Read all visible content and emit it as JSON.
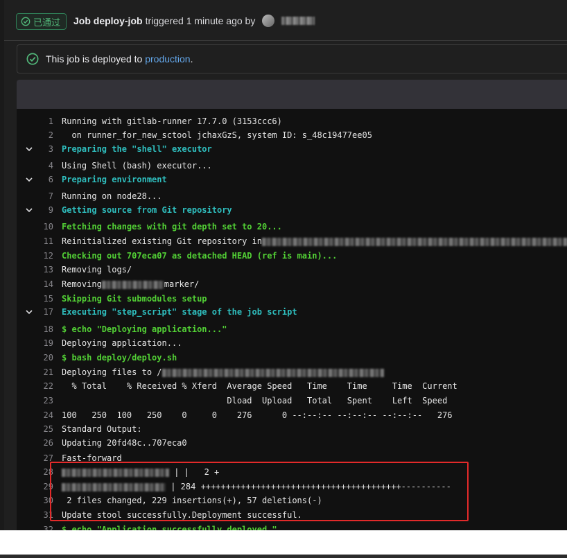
{
  "header": {
    "status_label": "已通过",
    "job_prefix": "Job",
    "job_name": "deploy-job",
    "job_suffix": "triggered 1 minute ago by"
  },
  "deployment": {
    "text": "This job is deployed to",
    "environment": "production",
    "period": "."
  },
  "log_lines": [
    {
      "num": "1",
      "text": "Running with gitlab-runner 17.7.0 (3153ccc6)"
    },
    {
      "num": "2",
      "text": "  on runner_for_new_sctool jchaxGzS, system ID: s_48c19477ee05"
    },
    {
      "num": "3",
      "text": "Preparing the \"shell\" executor",
      "style": "section"
    },
    {
      "num": "4",
      "text": "Using Shell (bash) executor..."
    },
    {
      "num": "6",
      "text": "Preparing environment",
      "style": "section"
    },
    {
      "num": "7",
      "text": "Running on node28..."
    },
    {
      "num": "9",
      "text": "Getting source from Git repository",
      "style": "section"
    },
    {
      "num": "10",
      "text": "Fetching changes with git depth set to 20...",
      "style": "green"
    },
    {
      "num": "11",
      "text": "Reinitialized existing Git repository in"
    },
    {
      "num": "12",
      "text": "Checking out 707eca07 as detached HEAD (ref is main)...",
      "style": "green"
    },
    {
      "num": "13",
      "text": "Removing logs/"
    },
    {
      "num": "14",
      "text": "Removing",
      "text2": "marker/"
    },
    {
      "num": "15",
      "text": "Skipping Git submodules setup",
      "style": "green"
    },
    {
      "num": "17",
      "text": "Executing \"step_script\" stage of the job script",
      "style": "section"
    },
    {
      "num": "18",
      "text": "$ echo \"Deploying application...\"",
      "style": "green"
    },
    {
      "num": "19",
      "text": "Deploying application..."
    },
    {
      "num": "20",
      "text": "$ bash deploy/deploy.sh",
      "style": "green"
    },
    {
      "num": "21",
      "text": "Deploying files to /"
    },
    {
      "num": "22",
      "text": "  % Total    % Received % Xferd  Average Speed   Time    Time     Time  Current"
    },
    {
      "num": "23",
      "text": "                                 Dload  Upload   Total   Spent    Left  Speed"
    },
    {
      "num": "24",
      "text": "100   250  100   250    0     0    276      0 --:--:-- --:--:-- --:--:--   276"
    },
    {
      "num": "25",
      "text": "Standard Output:"
    },
    {
      "num": "26",
      "text": "Updating 20fd48c..707eca0"
    },
    {
      "num": "27",
      "text": "Fast-forward"
    },
    {
      "num": "28",
      "text": "| |   2 +"
    },
    {
      "num": "29",
      "text": "| 284 ++++++++++++++++++++++++++++++++++++++++----------"
    },
    {
      "num": "30",
      "text": " 2 files changed, 229 insertions(+), 57 deletions(-)"
    },
    {
      "num": "31",
      "text": "Update stool successfully.Deployment successful."
    },
    {
      "num": "32",
      "text": "$ echo \"Application successfully deployed.\"",
      "style": "green"
    }
  ],
  "colors": {
    "success": "#52b87a",
    "link": "#63a6e9",
    "section": "#2fbfbf",
    "command": "#52d035",
    "highlight": "#e22a2a"
  }
}
